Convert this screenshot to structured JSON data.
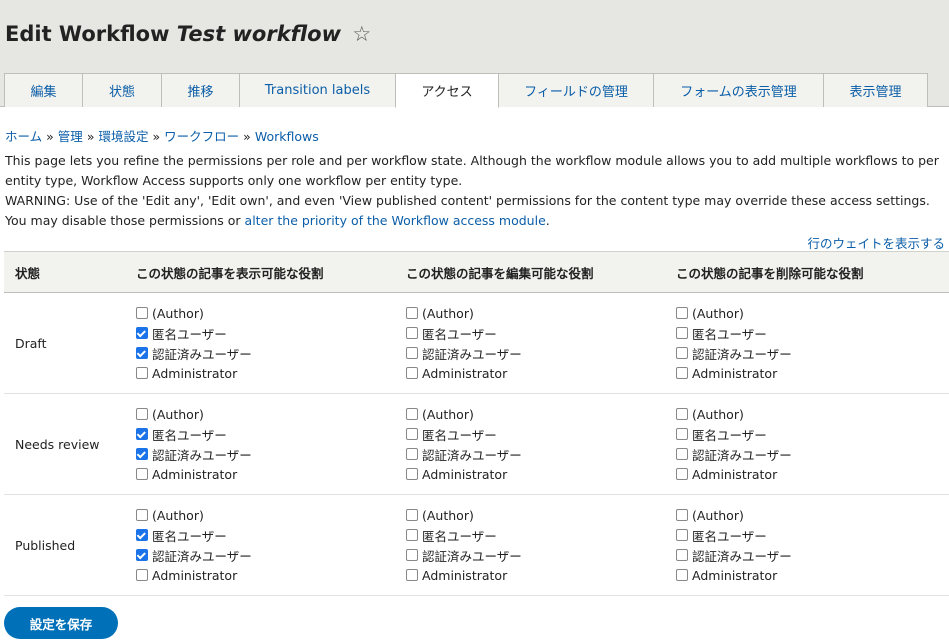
{
  "page": {
    "title_prefix": "Edit Workflow",
    "title_name": "Test workflow",
    "star_icon": "☆"
  },
  "tabs": [
    {
      "label": "編集",
      "active": false
    },
    {
      "label": "状態",
      "active": false
    },
    {
      "label": "推移",
      "active": false
    },
    {
      "label": "Transition labels",
      "active": false
    },
    {
      "label": "アクセス",
      "active": true
    },
    {
      "label": "フィールドの管理",
      "active": false
    },
    {
      "label": "フォームの表示管理",
      "active": false
    },
    {
      "label": "表示管理",
      "active": false
    }
  ],
  "breadcrumb": [
    "ホーム",
    "管理",
    "環境設定",
    "ワークフロー",
    "Workflows"
  ],
  "breadcrumb_separator": "»",
  "description": {
    "line1": "This page lets you refine the permissions per role and per workflow state. Although the workflow module allows you to add multiple workflows to per entity type, Workflow Access supports only one workflow per entity type.",
    "line2": "WARNING: Use of the 'Edit any', 'Edit own', and even 'View published content' permissions for the content type may override these access settings.",
    "line3_prefix": "You may disable those permissions or ",
    "line3_link": "alter the priority of the Workflow access module",
    "line3_suffix": "."
  },
  "weights_link": "行のウェイトを表示する",
  "table": {
    "headers": {
      "state": "状態",
      "view": "この状態の記事を表示可能な役割",
      "edit": "この状態の記事を編集可能な役割",
      "delete": "この状態の記事を削除可能な役割"
    },
    "roles": [
      "(Author)",
      "匿名ユーザー",
      "認証済みユーザー",
      "Administrator"
    ],
    "rows": [
      {
        "state": "Draft",
        "view": [
          false,
          true,
          true,
          false
        ],
        "edit": [
          false,
          false,
          false,
          false
        ],
        "delete": [
          false,
          false,
          false,
          false
        ]
      },
      {
        "state": "Needs review",
        "view": [
          false,
          true,
          true,
          false
        ],
        "edit": [
          false,
          false,
          false,
          false
        ],
        "delete": [
          false,
          false,
          false,
          false
        ]
      },
      {
        "state": "Published",
        "view": [
          false,
          true,
          true,
          false
        ],
        "edit": [
          false,
          false,
          false,
          false
        ],
        "delete": [
          false,
          false,
          false,
          false
        ]
      }
    ]
  },
  "save_button": "設定を保存",
  "colors": {
    "link": "#0b5ea8",
    "button": "#0071b8",
    "checkbox_checked": "#1a73e8",
    "header_bg": "#e6e6e3"
  }
}
